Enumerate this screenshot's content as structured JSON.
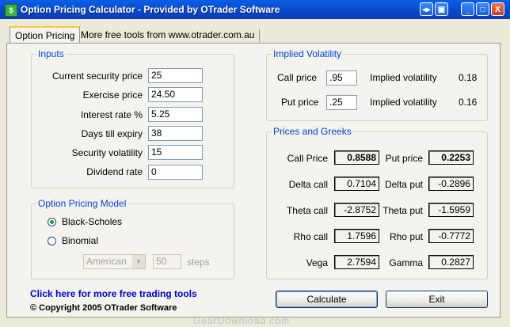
{
  "window": {
    "title": "Option Pricing Calculator - Provided by OTrader Software",
    "controls": {
      "extra1": "◂▸",
      "extra2": "▣",
      "minimize": "_",
      "maximize": "□",
      "close": "X"
    }
  },
  "tabs": [
    {
      "label": "Option Pricing",
      "active": true
    },
    {
      "label": "More free tools from www.otrader.com.au",
      "active": false
    }
  ],
  "inputs": {
    "legend": "Inputs",
    "fields": [
      {
        "label": "Current security price",
        "value": "25"
      },
      {
        "label": "Exercise price",
        "value": "24.50"
      },
      {
        "label": "Interest rate %",
        "value": "5.25"
      },
      {
        "label": "Days till expiry",
        "value": "38"
      },
      {
        "label": "Security volatility",
        "value": "15"
      },
      {
        "label": "Dividend rate",
        "value": "0"
      }
    ]
  },
  "model": {
    "legend": "Option Pricing Model",
    "options": [
      {
        "label": "Black-Scholes",
        "selected": true
      },
      {
        "label": "Binomial",
        "selected": false
      }
    ],
    "binomial_type": "American",
    "steps_value": "50",
    "steps_label": "steps"
  },
  "implied_volatility": {
    "legend": "Implied Volatility",
    "rows": [
      {
        "label": "Call price",
        "value": ".95",
        "result_label": "Implied volatility",
        "result": "0.18"
      },
      {
        "label": "Put price",
        "value": ".25",
        "result_label": "Implied volatility",
        "result": "0.16"
      }
    ]
  },
  "greeks": {
    "legend": "Prices and Greeks",
    "rows": [
      {
        "left_label": "Call Price",
        "left_value": "0.8588",
        "right_label": "Put price",
        "right_value": "0.2253",
        "bold": true
      },
      {
        "left_label": "Delta call",
        "left_value": "0.7104",
        "right_label": "Delta put",
        "right_value": "-0.2896",
        "bold": false
      },
      {
        "left_label": "Theta call",
        "left_value": "-2.8752",
        "right_label": "Theta put",
        "right_value": "-1.5959",
        "bold": false
      },
      {
        "left_label": "Rho call",
        "left_value": "1.7596",
        "right_label": "Rho put",
        "right_value": "-0.7772",
        "bold": false
      },
      {
        "left_label": "Vega",
        "left_value": "2.7594",
        "right_label": "Gamma",
        "right_value": "0.2827",
        "bold": false
      }
    ]
  },
  "footer": {
    "link": "Click here for more free trading tools",
    "copyright": "© Copyright 2005 OTrader Software"
  },
  "buttons": {
    "calculate": "Calculate",
    "exit": "Exit"
  },
  "watermark": "GearDownload.com",
  "colors": {
    "titlebar": "#0A5FE6",
    "legend": "#0046D5",
    "link": "#0000CC",
    "face": "#ECE9D8"
  }
}
